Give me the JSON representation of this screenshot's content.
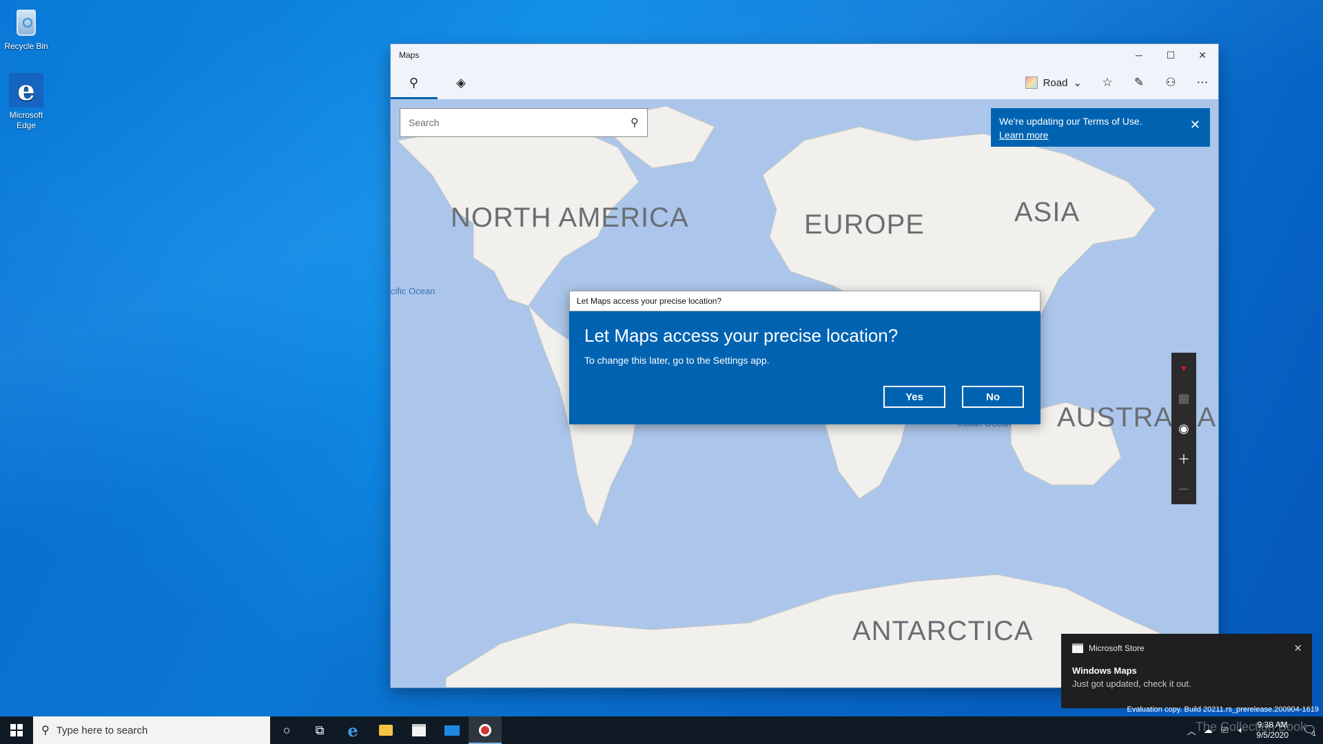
{
  "desktop": {
    "icons": [
      {
        "label": "Recycle Bin",
        "icon": "recycle-bin-icon"
      },
      {
        "label": "Microsoft Edge",
        "icon": "edge-icon"
      }
    ]
  },
  "window": {
    "title": "Maps",
    "controls": {
      "minimize": "─",
      "maximize": "☐",
      "close": "✕"
    },
    "toolbar": {
      "search_icon": "search-icon",
      "directions_icon": "directions-icon",
      "map_style_label": "Road",
      "favorites_icon": "favorites-icon",
      "ink_icon": "pen-icon",
      "account_icon": "account-icon",
      "more_icon": "more-icon"
    },
    "search": {
      "placeholder": "Search"
    },
    "terms_banner": {
      "text": "We're updating our Terms of Use.",
      "link": "Learn more"
    },
    "map_labels": {
      "north_america": "NORTH AMERICA",
      "europe": "EUROPE",
      "asia": "ASIA",
      "australia": "AUSTRALIA",
      "antarctica": "ANTARCTICA",
      "pacific": "cific Ocean",
      "indian": "Indian Ocean"
    },
    "map_controls": [
      "compass-icon",
      "3d-icon",
      "location-icon",
      "zoom-in-icon",
      "zoom-out-icon"
    ]
  },
  "dialog": {
    "title": "Let Maps access your precise location?",
    "heading": "Let Maps access your precise location?",
    "text": "To change this later, go to the Settings app.",
    "yes": "Yes",
    "no": "No"
  },
  "toast": {
    "app": "Microsoft Store",
    "title": "Windows Maps",
    "text": "Just got updated, check it out."
  },
  "taskbar": {
    "search_placeholder": "Type here to search",
    "time": "9:38 AM",
    "date": "9/5/2020",
    "notification_count": "1"
  },
  "eval_text": "Evaluation copy. Build 20211.rs_prerelease.200904-1619",
  "watermark": "The Collection Book",
  "colors": {
    "accent": "#0063b1",
    "taskbar": "#101a24",
    "map_water": "#abc6ea",
    "map_land": "#f2f0ec"
  }
}
